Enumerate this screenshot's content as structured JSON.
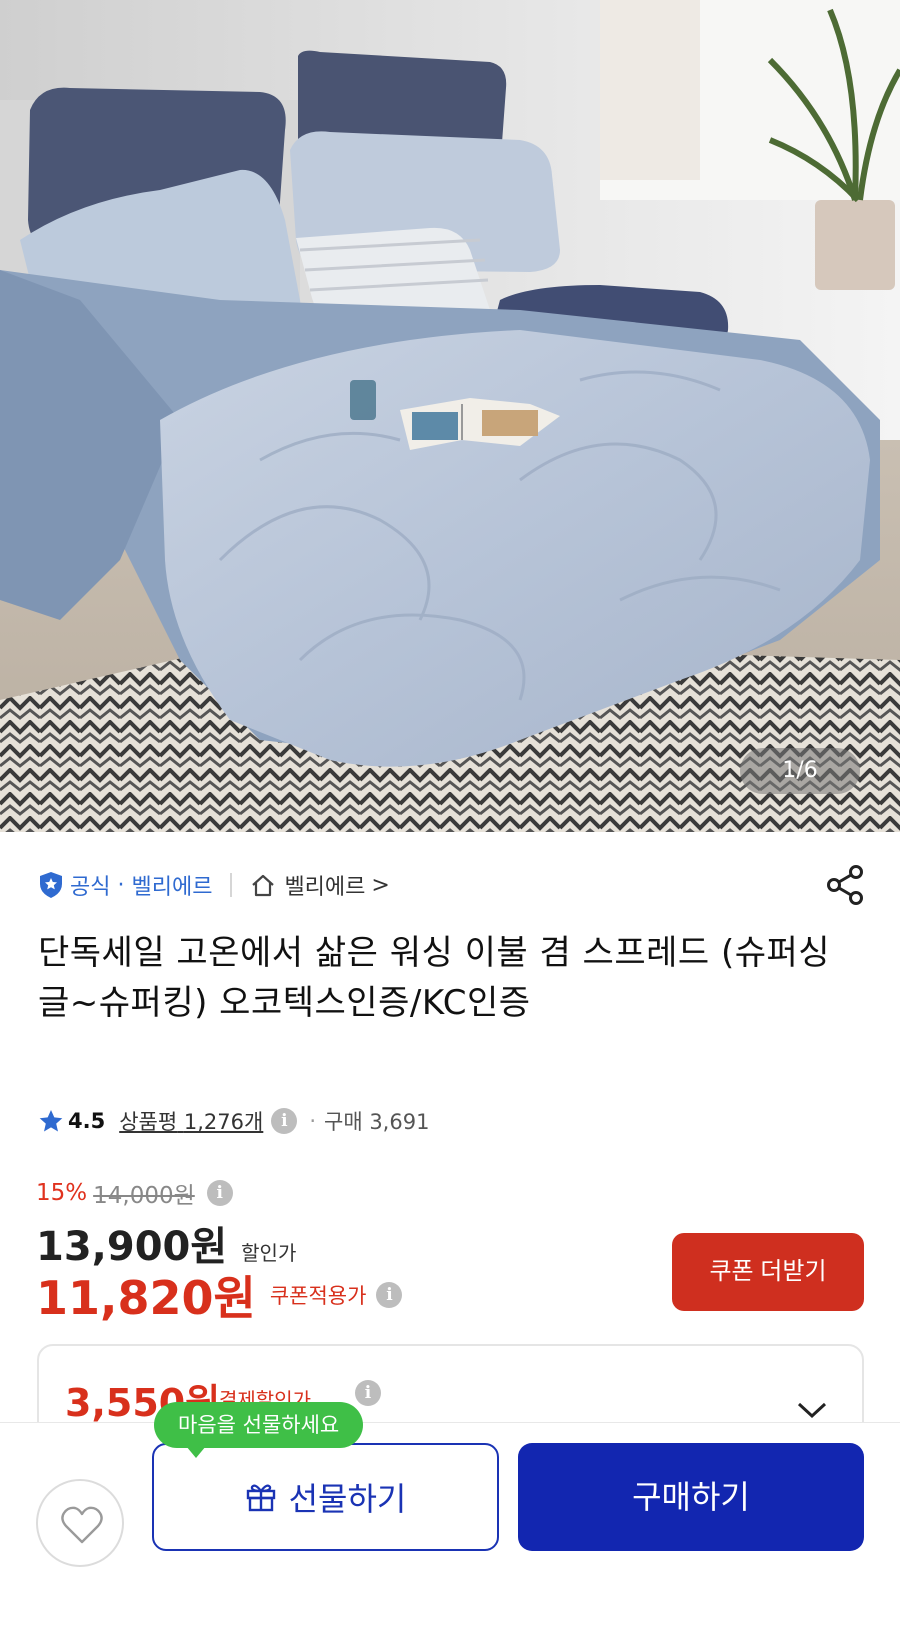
{
  "hero": {
    "image_counter": "1/6",
    "image_icon": "bedding-photo"
  },
  "seller": {
    "official_label": "공식",
    "brand_name": "벨리에르",
    "store_name": "벨리에르",
    "store_chevron": ">",
    "official_icon": "shield-check-icon",
    "store_icon": "home-icon",
    "share_icon": "share-icon"
  },
  "product": {
    "title": "단독세일 고온에서 삶은 워싱 이불 겸 스프레드 (슈퍼싱글~슈퍼킹) 오코텍스인증/KC인증"
  },
  "rating": {
    "score": "4.5",
    "review_label": "상품평",
    "review_count": "1,276개",
    "purchase_label": "구매 3,691",
    "star_icon": "star-icon"
  },
  "price": {
    "discount_rate": "15%",
    "original_price": "14,000원",
    "sale_price": "13,900원",
    "sale_label": "할인가",
    "coupon_price": "11,820원",
    "coupon_label": "쿠폰적용가",
    "coupon_button": "쿠폰 더받기",
    "info_glyph": "i"
  },
  "payment": {
    "price": "3,550원",
    "label": "결제할인가",
    "chevron_icon": "chevron-down-icon"
  },
  "actions": {
    "tooltip": "마음을 선물하세요",
    "gift_label": "선물하기",
    "buy_label": "구매하기",
    "wish_icon": "heart-icon",
    "gift_icon": "gift-icon"
  },
  "colors": {
    "accent_blue": "#1226b0",
    "sale_red": "#d8301c",
    "tooltip_green": "#3fbf47",
    "official_blue": "#2f6ad0"
  }
}
